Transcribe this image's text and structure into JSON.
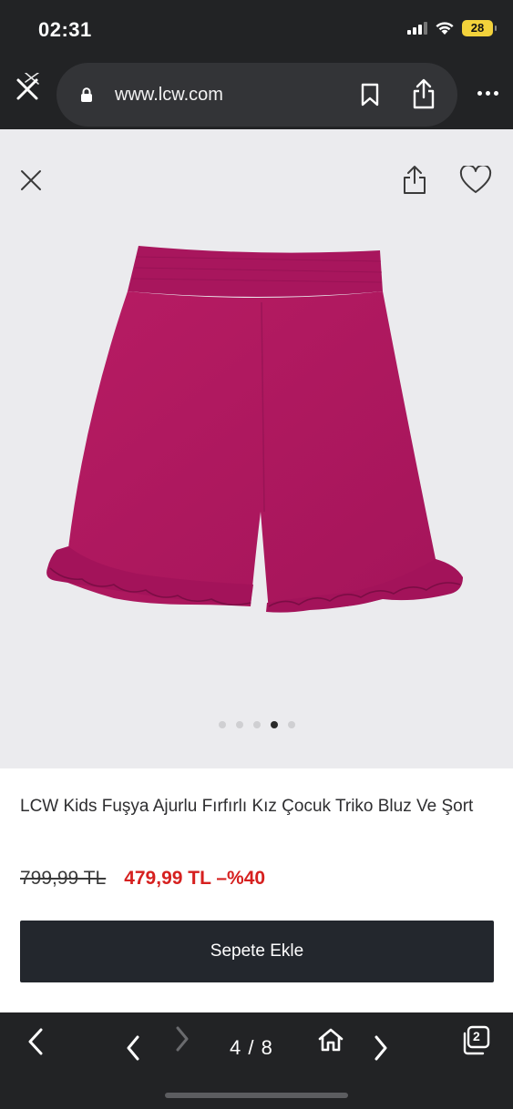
{
  "status_bar": {
    "time": "02:31",
    "battery_level": "28"
  },
  "browser": {
    "url": "www.lcw.com",
    "icons": [
      "close-tab-icon",
      "lock-icon",
      "bookmark-icon",
      "share-icon",
      "more-icon"
    ]
  },
  "gallery": {
    "image_description": "Fuchsia knit shorts with ruffled hems",
    "image_count": 5,
    "active_image_index": 3,
    "icons": [
      "close-icon",
      "share-icon",
      "heart-icon"
    ]
  },
  "product": {
    "title": "LCW Kids Fuşya Ajurlu Fırfırlı Kız Çocuk Triko Bluz Ve Şort",
    "old_price": "799,99 TL",
    "new_price": "479,99 TL –%40",
    "add_to_cart_label": "Sepete Ekle"
  },
  "toolbar": {
    "page_indicator": "4 / 8",
    "tab_count": "2",
    "icons": [
      "back-icon",
      "prev-icon",
      "next-icon-disabled",
      "home-icon",
      "next-icon",
      "tabs-icon"
    ]
  },
  "colors": {
    "chrome_bg": "#222325",
    "gallery_bg": "#ebebee",
    "sale_price": "#d6201f",
    "button_bg": "#23272d",
    "product_color": "#b0185f"
  }
}
